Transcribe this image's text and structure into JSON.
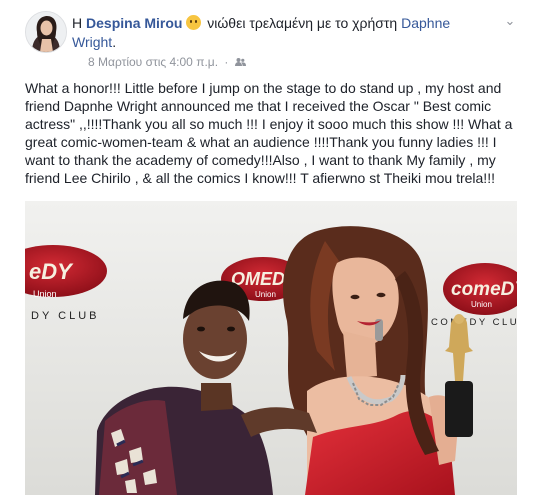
{
  "post": {
    "author": "Despina Mirou",
    "prefix": "Η",
    "feeling_text": "νιώθει τρελαμένη με το χρήστη",
    "tagged_user": "Daphne Wright",
    "period": ".",
    "timestamp": "8 Μαρτίου στις 4:00 π.μ.",
    "privacy_icon": "friends-icon",
    "menu_icon": "chevron-down-icon",
    "text": "What a honor!!! Little before I jump on the stage to do stand up , my host and friend Dapnhe Wright announced me that I received the Oscar \" Best comic actress\" ,,!!!!Thank you all so much !!! I enjoy it sooo much this show !!! What a great comic-women-team & what an audience !!!!Thank you funny ladies !!! I want to thank the academy of comedy!!!Also , I want to thank My family , my friend Lee Chirilo , & all the comics I know!!! T afierwno st Theiki mou trela!!!"
  },
  "photo": {
    "sign_logo": "Comedy Union",
    "sign_subtitle": "COMEDY CLUB",
    "sign_subtitle_partial": "DY CLUB",
    "sign_logo_short": "Union"
  },
  "colors": {
    "link": "#365899",
    "meta": "#90949c",
    "text": "#1d2129",
    "sign_red": "#b51a28",
    "dress_red": "#d8232d"
  }
}
